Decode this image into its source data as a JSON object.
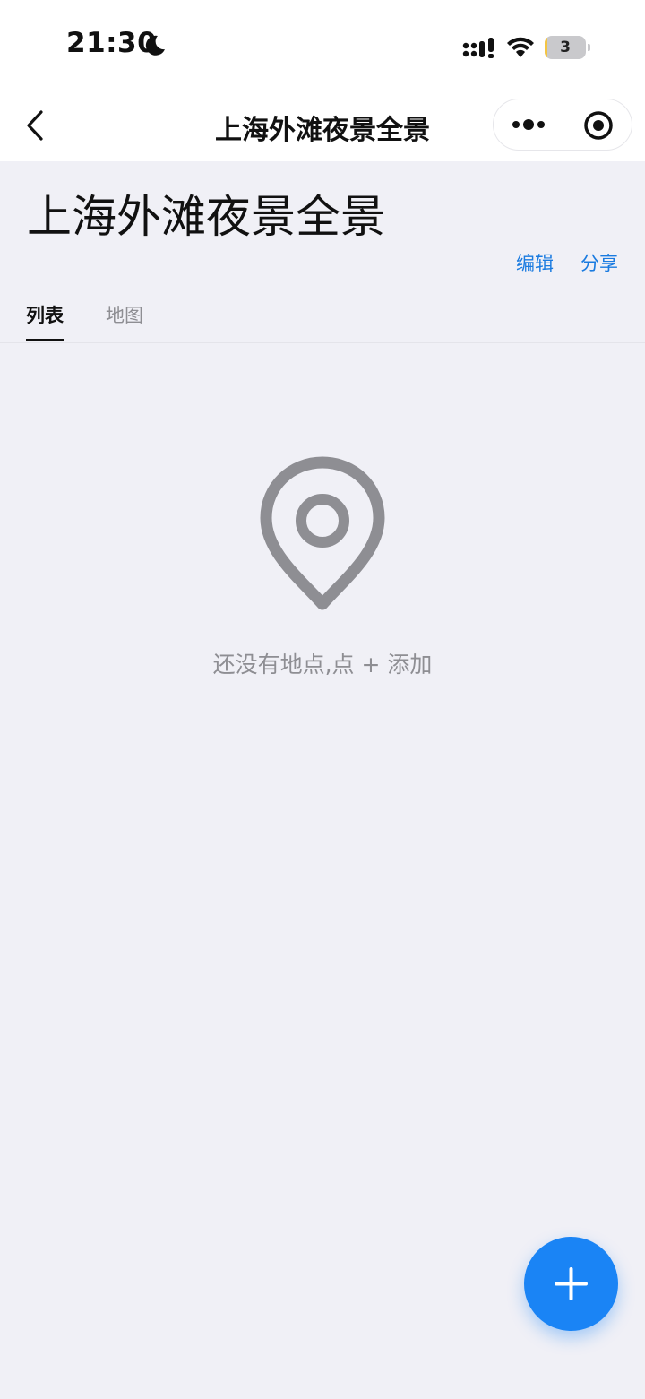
{
  "status_bar": {
    "time": "21:30",
    "battery": "3",
    "battery_level": 0.06,
    "icons": [
      "moon-icon",
      "signal-icon",
      "wifi-icon",
      "battery-icon"
    ]
  },
  "nav": {
    "title": "上海外滩夜景全景",
    "icons": [
      "back-icon",
      "more-icon",
      "target-icon"
    ]
  },
  "page": {
    "title": "上海外滩夜景全景",
    "edit_label": "编辑",
    "share_label": "分享"
  },
  "tabs": [
    {
      "label": "列表",
      "active": true
    },
    {
      "label": "地图",
      "active": false
    }
  ],
  "empty_state": {
    "icon": "location-pin-icon",
    "text": "还没有地点,点 + 添加"
  },
  "fab": {
    "icon": "plus-icon"
  },
  "colors": {
    "accent": "#1a84f5",
    "link": "#1a7be0",
    "background": "#f0f0f6",
    "muted": "#8e8e93"
  }
}
